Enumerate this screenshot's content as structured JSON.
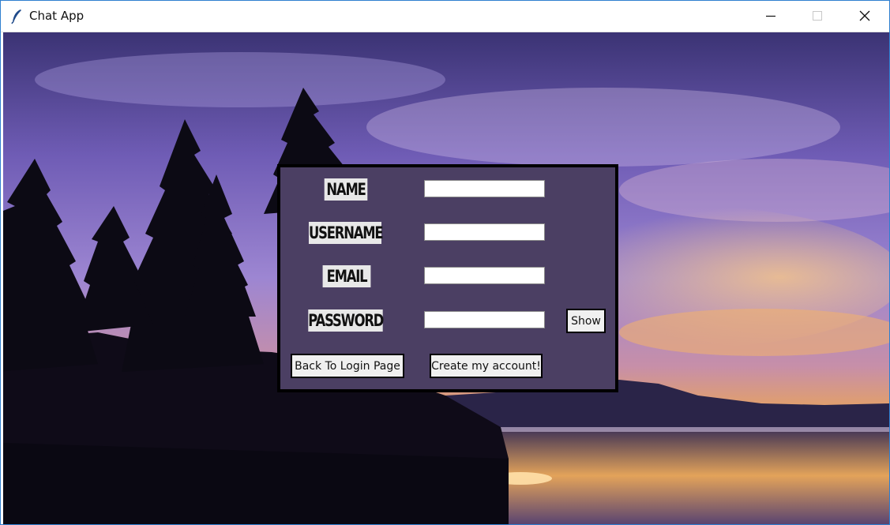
{
  "window": {
    "title": "Chat App",
    "controls": {
      "minimize": "minimize",
      "maximize": "maximize",
      "close": "close"
    }
  },
  "form": {
    "labels": {
      "name": "NAME",
      "username": "USERNAME",
      "email": "EMAIL",
      "password": "PASSWORD"
    },
    "fields": {
      "name": "",
      "username": "",
      "email": "",
      "password": ""
    },
    "buttons": {
      "show": "Show",
      "back": "Back To Login Page",
      "create": "Create my account!"
    }
  },
  "colors": {
    "form_bg": "#4b3f63",
    "sky_top": "#3a3170",
    "sky_mid": "#7c66c2",
    "sunset": "#e6a45c"
  }
}
